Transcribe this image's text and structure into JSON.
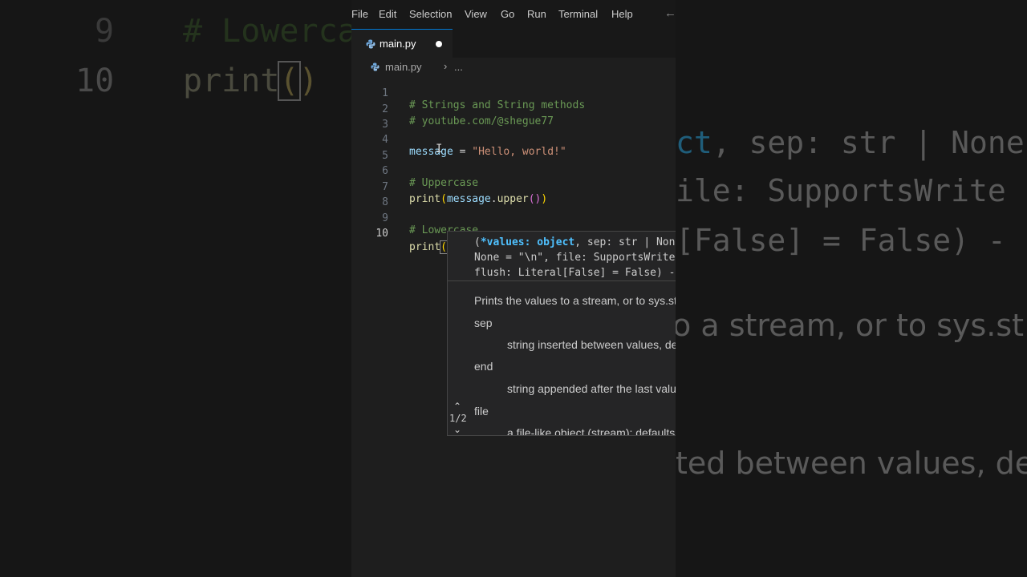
{
  "background_left": {
    "line_9_number": "9",
    "line_9_code": "# Lowercase",
    "line_10_number": "10",
    "line_10_prefix": "print",
    "line_10_open": "(",
    "line_10_close": ")"
  },
  "background_right": {
    "line_a_prefix": "ct",
    "line_a_rest": ", sep: str | None",
    "line_b": "ile: SupportsWrite",
    "line_c": "[False] = False) -",
    "line_d": "o a stream, or to sys.st",
    "line_e": "ted between values, de"
  },
  "menu": {
    "items": [
      "File",
      "Edit",
      "Selection",
      "View",
      "Go",
      "Run",
      "Terminal",
      "Help"
    ],
    "back_icon": "arrow-left-icon"
  },
  "tab": {
    "label": "main.py",
    "icon": "python-file-icon",
    "modified_indicator": "unsaved-dot-icon"
  },
  "breadcrumb": {
    "file": "main.py",
    "separator": "›",
    "rest": "..."
  },
  "code": {
    "active_line": 10,
    "lines": [
      {
        "n": "1",
        "text": "# Strings and String methods"
      },
      {
        "n": "2",
        "text": "# youtube.com/@shegue77"
      },
      {
        "n": "3",
        "text": ""
      },
      {
        "n": "4",
        "var": "message",
        "op": " = ",
        "str": "\"Hello, world!\""
      },
      {
        "n": "5",
        "text": ""
      },
      {
        "n": "6",
        "text": "# Uppercase"
      },
      {
        "n": "7",
        "fn": "print",
        "p_open": "(",
        "obj": "message",
        "dot": ".",
        "method": "upper",
        "inner": "()",
        "p_close": ")"
      },
      {
        "n": "8",
        "text": ""
      },
      {
        "n": "9",
        "text": "# Lowercase"
      },
      {
        "n": "10",
        "fn": "print",
        "p_open": "(",
        "p_close": ")"
      }
    ]
  },
  "hover": {
    "sig_line1_open": "(",
    "sig_line1_highlight": "*values: object",
    "sig_line1_rest": ", sep: str | Non",
    "sig_line2": "None = \"\\n\", file: SupportsWrite",
    "sig_line3": "flush: Literal[False] = False) -",
    "description": "Prints the values to a stream, or to sys.st",
    "params": [
      {
        "name": "sep",
        "desc": "string inserted between values, de"
      },
      {
        "name": "end",
        "desc": "string appended after the last valu"
      },
      {
        "name": "file",
        "desc": "a file-like object (stream): defaults"
      }
    ],
    "counter": "1/2",
    "up_icon": "chevron-up-icon",
    "down_icon": "chevron-down-icon"
  },
  "colors": {
    "editor_bg": "#1e1e1e",
    "comment": "#6a9955",
    "variable": "#9cdcfe",
    "string": "#ce9178",
    "function": "#dcdcaa",
    "bracket_1": "#ffd700",
    "bracket_2": "#da70d6",
    "param_highlight": "#4fc1ff",
    "accent": "#0078d4"
  }
}
